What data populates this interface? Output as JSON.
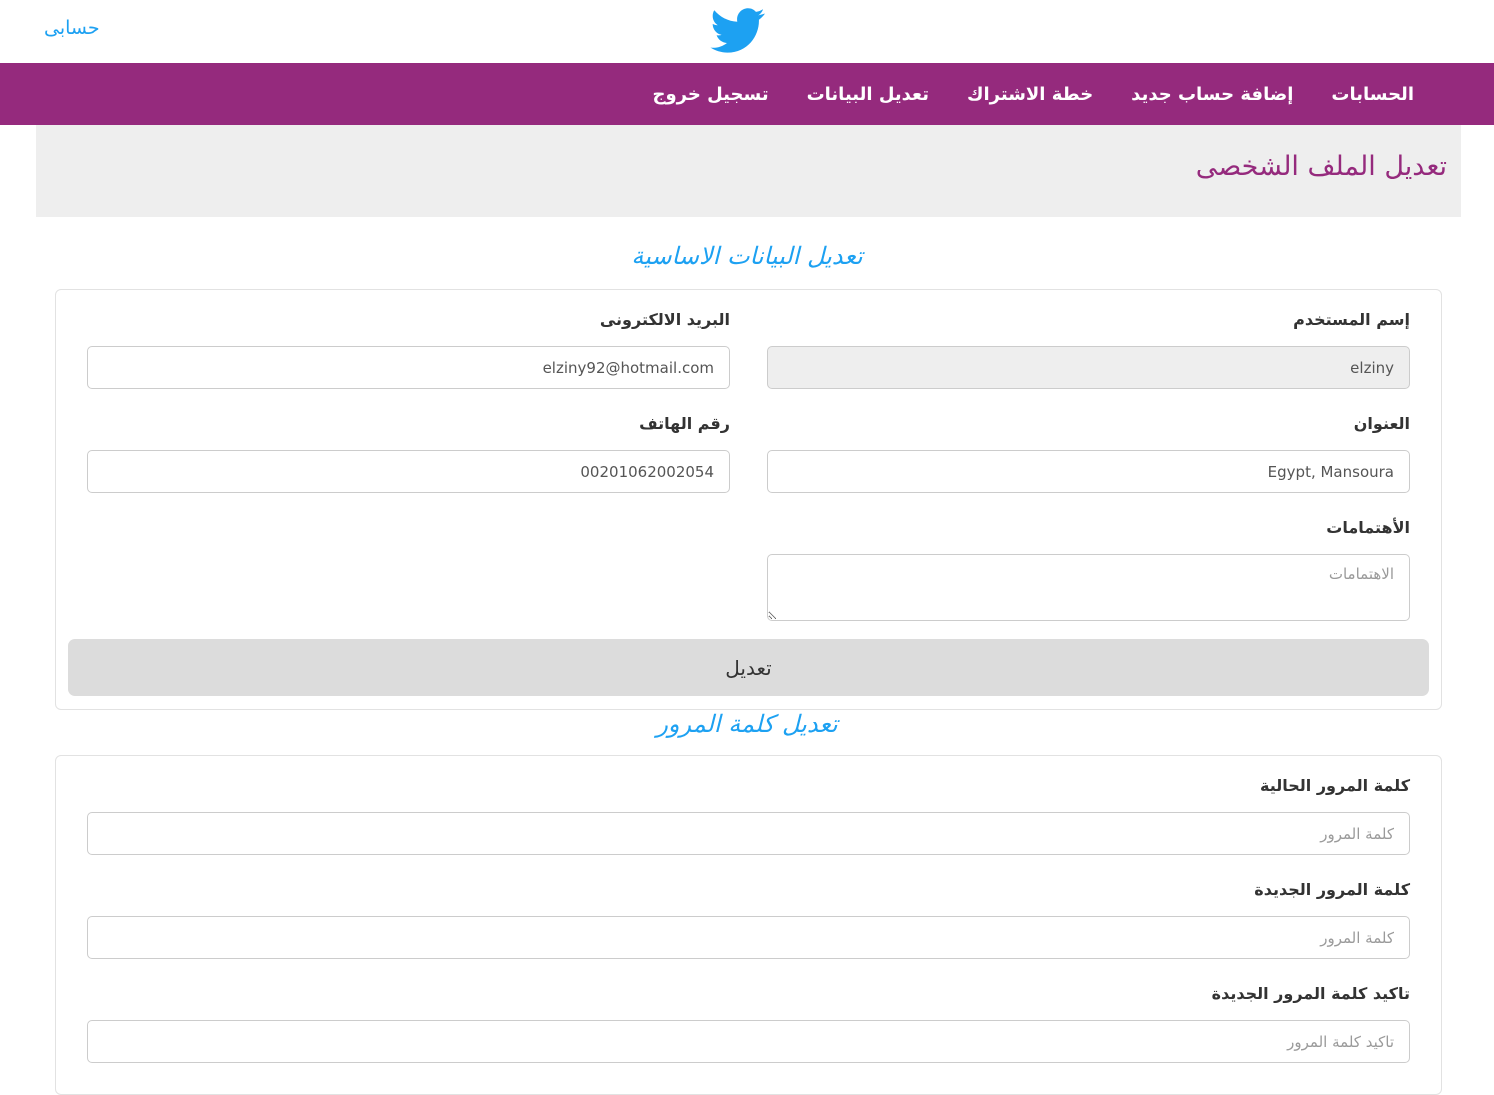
{
  "header": {
    "account_label": "حسابى",
    "logo_icon": "twitter-bird-icon",
    "brand_color": "#1da1f2"
  },
  "nav": {
    "background": "#952a7d",
    "items": [
      {
        "label": "الحسابات"
      },
      {
        "label": "إضافة حساب جديد"
      },
      {
        "label": "خطة الاشتراك"
      },
      {
        "label": "تعديل البيانات"
      },
      {
        "label": "تسجيل خروج"
      }
    ]
  },
  "page": {
    "title": "تعديل الملف الشخصى"
  },
  "basic_info": {
    "heading": "تعديل البيانات الاساسية",
    "username": {
      "label": "إسم المستخدم",
      "value": "elziny"
    },
    "email": {
      "label": "البريد الالكترونى",
      "value": "elziny92@hotmail.com"
    },
    "address": {
      "label": "العنوان",
      "value": "Egypt, Mansoura"
    },
    "phone": {
      "label": "رقم الهاتف",
      "value": "00201062002054"
    },
    "interests": {
      "label": "الأهتمامات",
      "placeholder": "الاهتمامات"
    },
    "submit_label": "تعديل"
  },
  "password": {
    "heading": "تعديل كلمة المرور",
    "current": {
      "label": "كلمة المرور الحالية",
      "placeholder": "كلمة المرور"
    },
    "new": {
      "label": "كلمة المرور الجديدة",
      "placeholder": "كلمة المرور"
    },
    "confirm": {
      "label": "تاكيد كلمة المرور الجديدة",
      "placeholder": "تاكيد كلمة المرور"
    }
  }
}
